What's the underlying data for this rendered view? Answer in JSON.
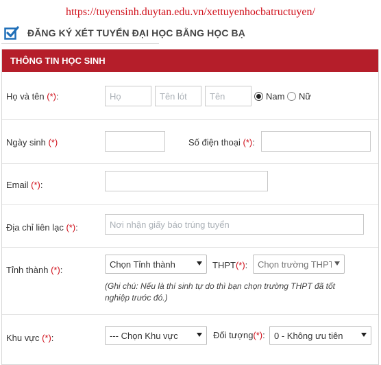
{
  "url": "https://tuyensinh.duytan.edu.vn/xettuyenhocbatructuyen/",
  "heading": "ĐĂNG KÝ XÉT TUYỂN ĐẠI HỌC BẰNG HỌC BẠ",
  "section_title": "THÔNG TIN HỌC SINH",
  "required_mark": "(*)",
  "fields": {
    "full_name": {
      "label": "Họ và tên",
      "suffix": ":",
      "ho_placeholder": "Họ",
      "ten_lot_placeholder": "Tên lót",
      "ten_placeholder": "Tên"
    },
    "gender": {
      "male": "Nam",
      "female": "Nữ",
      "selected": "Nam"
    },
    "dob": {
      "label": "Ngày sinh",
      "value": ""
    },
    "phone": {
      "label": "Số điện thoại",
      "suffix": ":",
      "value": ""
    },
    "email": {
      "label": "Email",
      "suffix": ":",
      "value": ""
    },
    "address": {
      "label": "Địa chỉ liên lạc",
      "suffix": ":",
      "placeholder": "Nơi nhận giấy báo trúng tuyển"
    },
    "province": {
      "label": "Tỉnh thành",
      "suffix": ":",
      "selected": "Chọn Tỉnh thành"
    },
    "school": {
      "label": "THPT",
      "suffix": ":",
      "selected": "Chọn trường THPT"
    },
    "note": "(Ghi chú: Nếu là thí sinh tự do thì bạn chọn trường THPT đã tốt nghiệp trước đó.)",
    "region": {
      "label": "Khu vực",
      "suffix": ":",
      "selected": "--- Chọn Khu vực"
    },
    "priority": {
      "label": "Đối tượng",
      "suffix": ":",
      "selected": "0 - Không ưu tiên"
    }
  },
  "colors": {
    "accent": "#b51e2a",
    "url": "#d0101b",
    "check_icon": "#1f6fb8"
  },
  "icons": {
    "heading": "checkbox-checked-icon",
    "dropdown": "caret-down-icon"
  }
}
